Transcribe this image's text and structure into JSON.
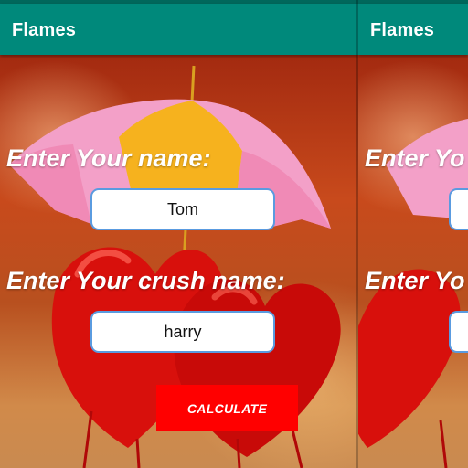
{
  "app": {
    "title": "Flames",
    "bar_color": "#00897b",
    "status_color": "#00675b"
  },
  "form": {
    "your_name_label": "Enter Your name:",
    "your_name_value": "Tom",
    "crush_name_label": "Enter Your crush name:",
    "crush_name_value": "harry",
    "calculate_label": "CALCULATE",
    "button_color": "#ff0000",
    "field_border_color": "#5a9be0"
  },
  "ghost": {
    "title": "Flames",
    "your_name_label_partial": "Enter Yo",
    "crush_name_label_partial": "Enter Yo"
  },
  "background": {
    "description_icon": "umbrella-hearts-image"
  }
}
